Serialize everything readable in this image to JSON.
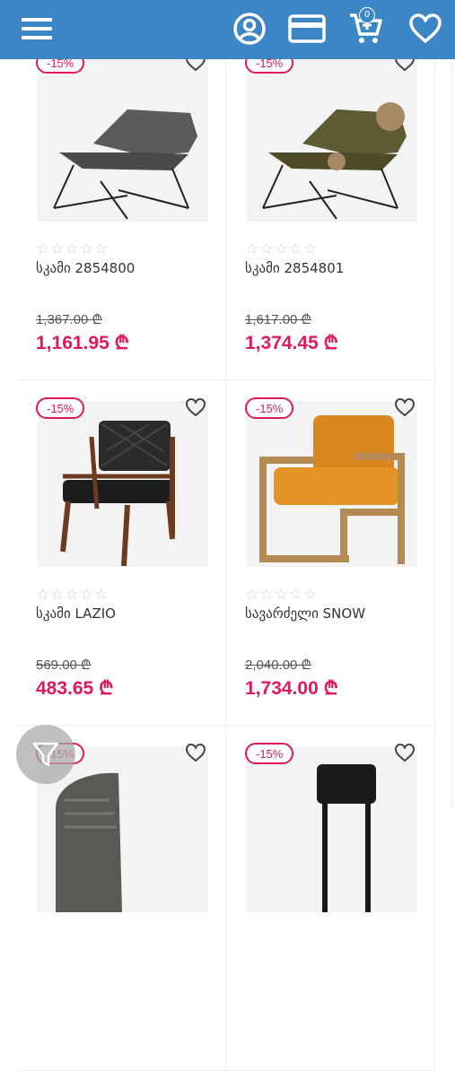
{
  "header": {
    "menu_icon": "hamburger-icon",
    "account_icon": "user-circle-icon",
    "card_icon": "credit-card-icon",
    "cart_icon": "cart-icon",
    "cart_count": "0",
    "wishlist_icon": "heart-icon"
  },
  "products": [
    {
      "discount": "-15%",
      "name": "სკამი 2854800",
      "old_price": "1,367.00 ₾",
      "new_price": "1,161.95 ₾",
      "rating": "☆☆☆☆☆",
      "image": "grey-lounge-chair"
    },
    {
      "discount": "-15%",
      "name": "სკამი 2854801",
      "old_price": "1,617.00 ₾",
      "new_price": "1,374.45 ₾",
      "rating": "☆☆☆☆☆",
      "image": "olive-lounge-chair"
    },
    {
      "discount": "-15%",
      "name": "სკამი LAZIO",
      "old_price": "569.00 ₾",
      "new_price": "483.65 ₾",
      "rating": "☆☆☆☆☆",
      "image": "wooden-leather-armchair"
    },
    {
      "discount": "-15%",
      "name": "სავარძელი SNOW",
      "old_price": "2,040.00 ₾",
      "new_price": "1,734.00 ₾",
      "rating": "☆☆☆☆☆",
      "image": "orange-armchair"
    },
    {
      "discount": "-15%",
      "image": "tweed-chair"
    },
    {
      "discount": "-15%",
      "image": "black-chair"
    }
  ],
  "filter_icon": "filter-icon",
  "colors": {
    "header": "#3d86c6",
    "accent": "#e01a59"
  }
}
